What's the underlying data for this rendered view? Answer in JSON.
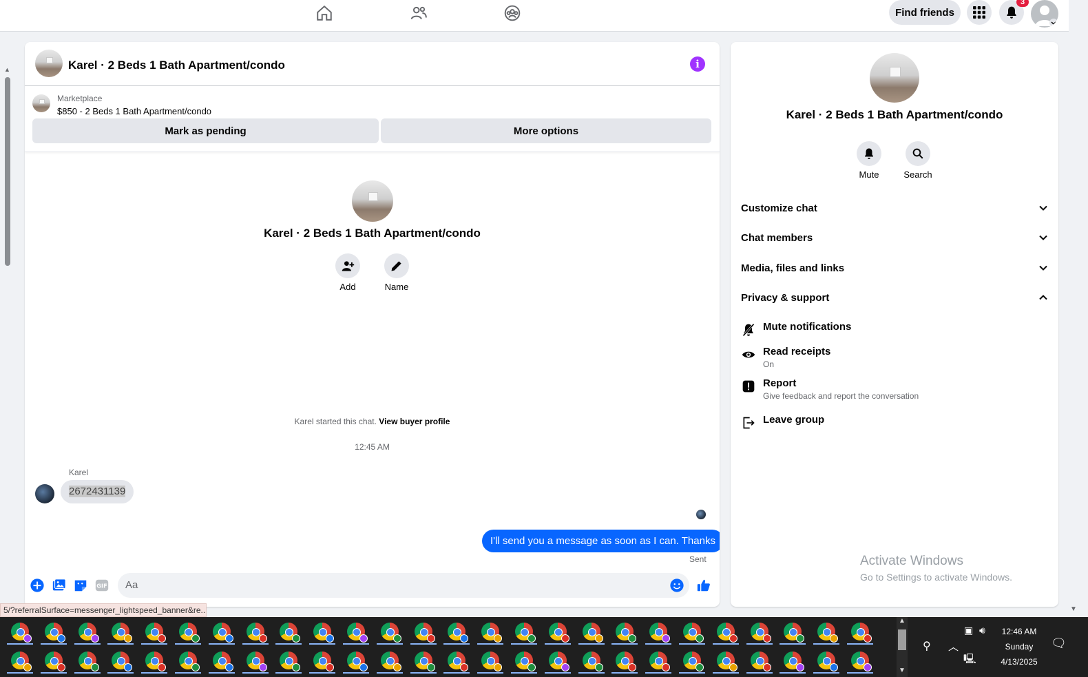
{
  "topbar": {
    "find_friends": "Find friends",
    "notification_count": "3"
  },
  "chat": {
    "title": "Karel · 2 Beds 1 Bath Apartment/condo",
    "listing": {
      "label": "Marketplace",
      "title": "$850 - 2 Beds 1 Bath Apartment/condo"
    },
    "mark_pending": "Mark as pending",
    "more_options": "More options",
    "center_title": "Karel · 2 Beds 1 Bath Apartment/condo",
    "add_label": "Add",
    "name_label": "Name",
    "started_text": "Karel started this chat.",
    "view_buyer": "View buyer profile",
    "timestamp": "12:45 AM",
    "messages": [
      {
        "sender": "Karel",
        "text": "2672431139",
        "direction": "incoming"
      },
      {
        "text": "I'll send you a message as soon as I can. Thanks",
        "direction": "outgoing",
        "status": "Sent"
      }
    ],
    "composer_placeholder": "Aa"
  },
  "panel": {
    "title": "Karel · 2 Beds 1 Bath Apartment/condo",
    "mute": "Mute",
    "search": "Search",
    "sections": [
      "Customize chat",
      "Chat members",
      "Media, files and links",
      "Privacy & support"
    ],
    "privacy_options": [
      {
        "title": "Mute notifications",
        "sub": "",
        "icon": "bell-off-icon"
      },
      {
        "title": "Read receipts",
        "sub": "On",
        "icon": "eye-icon"
      },
      {
        "title": "Report",
        "sub": "Give feedback and report the conversation",
        "icon": "report-icon"
      },
      {
        "title": "Leave group",
        "sub": "",
        "icon": "leave-icon"
      }
    ]
  },
  "watermark": {
    "line1": "Activate Windows",
    "line2": "Go to Settings to activate Windows."
  },
  "status_url": "5/?referralSurface=messenger_lightspeed_banner&re...",
  "taskbar": {
    "time": "12:46 AM",
    "day": "Sunday",
    "date": "4/13/2025"
  },
  "colors": {
    "accent": "#0866ff",
    "info": "#a033ff",
    "badge": "#e41e3f"
  }
}
